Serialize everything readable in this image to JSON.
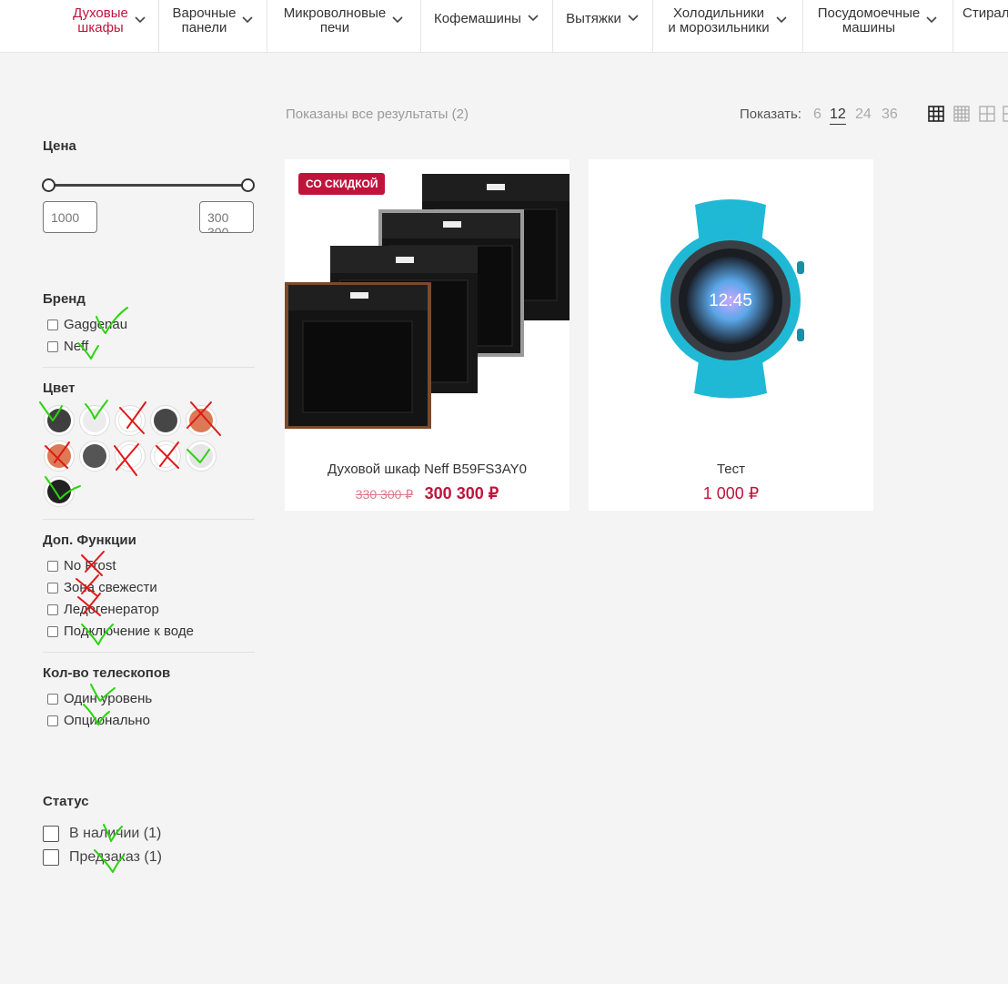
{
  "nav": {
    "items": [
      {
        "label": "Духовые\nшкафы",
        "active": true
      },
      {
        "label": "Варочные\nпанели"
      },
      {
        "label": "Микроволновые\nпечи"
      },
      {
        "label": "Кофемашины"
      },
      {
        "label": "Вытяжки"
      },
      {
        "label": "Холодильники\nи морозильники"
      },
      {
        "label": "Посудомоечные\nмашины"
      },
      {
        "label": "Стирал"
      }
    ]
  },
  "toolbar": {
    "results_text": "Показаны все результаты (2)",
    "show_label": "Показать:",
    "per_page_options": [
      "6",
      "12",
      "24",
      "36"
    ],
    "per_page_selected": "12",
    "view_icons": [
      "grid-3-icon",
      "grid-4-icon",
      "grid-2-icon",
      "list-icon"
    ]
  },
  "filters": {
    "price": {
      "title": "Цена",
      "min_value": "1000",
      "max_value": "300 300"
    },
    "brand": {
      "title": "Бренд",
      "options": [
        "Gaggenau",
        "Neff"
      ]
    },
    "color": {
      "title": "Цвет",
      "swatches": [
        "#3f3f3f",
        "#ececec",
        "#ffffff",
        "#464646",
        "#dc7a55",
        "#dc7a55",
        "#555555",
        "#ffffff",
        "#ffffff",
        "#e6e6e6",
        "#222222"
      ]
    },
    "features": {
      "title": "Доп. Функции",
      "options": [
        "No Frost",
        "Зона свежести",
        "Ледогенератор",
        "Подключение к воде"
      ]
    },
    "telescopes": {
      "title": "Кол-во телескопов",
      "options": [
        "Один уровень",
        "Опционально"
      ]
    },
    "status": {
      "title": "Статус",
      "options": [
        "В наличии (1)",
        "Предзаказ (1)"
      ]
    }
  },
  "products": [
    {
      "badge": "СО СКИДКОЙ",
      "title": "Духовой шкаф Neff B59FS3AY0",
      "old_price": "330 300 ₽",
      "price": "300 300 ₽",
      "image": "oven-image"
    },
    {
      "title": "Тест",
      "price": "1 000 ₽",
      "image": "smartwatch-image",
      "watch_time": "12:45"
    }
  ],
  "colors": {
    "accent": "#c0143c",
    "mark_green": "#2bd40f",
    "mark_red": "#e01818"
  }
}
